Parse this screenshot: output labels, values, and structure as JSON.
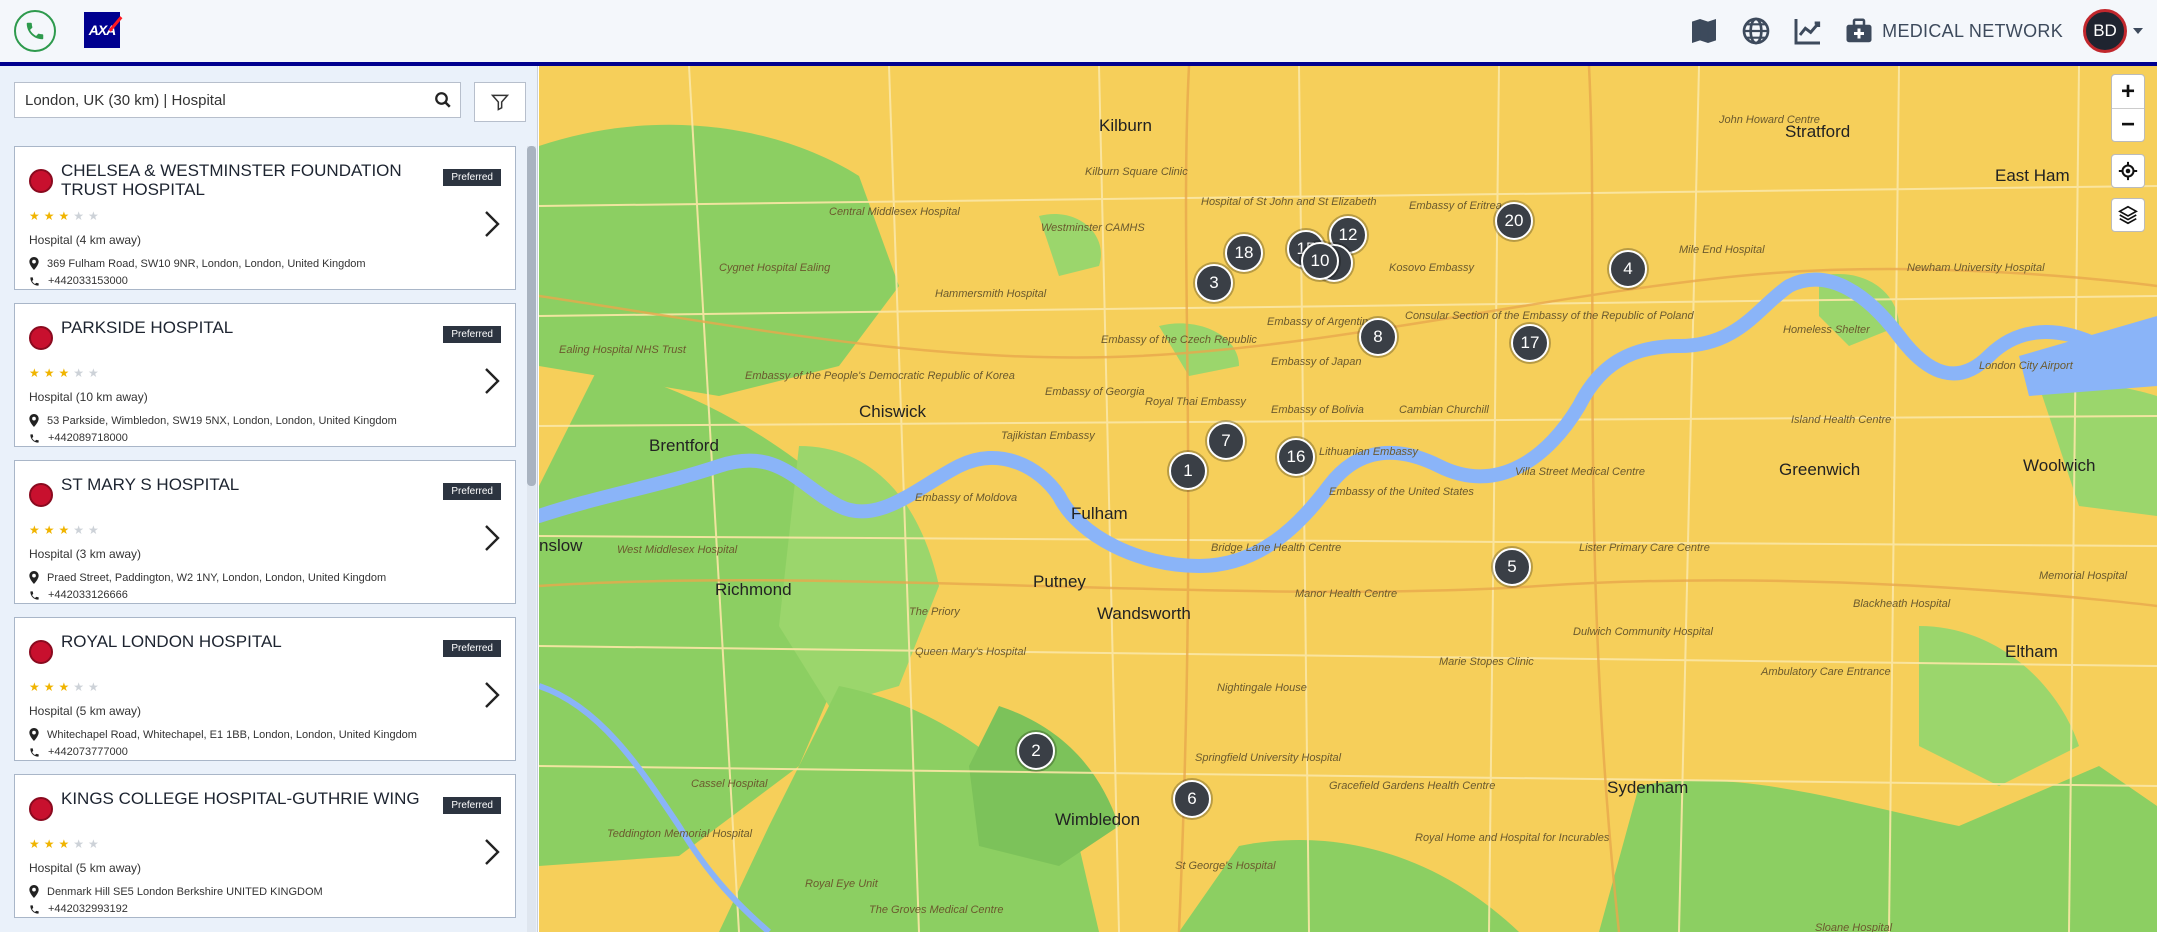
{
  "header": {
    "phone_icon": "phone-icon",
    "logo_text": "AXA",
    "icons": [
      "map-icon",
      "globe-icon",
      "chart-icon",
      "medical-kit-icon"
    ],
    "medical_network_label": "MEDICAL NETWORK",
    "avatar_initials": "BD",
    "brand_color": "#00008f",
    "accent_color": "#c8102e"
  },
  "search": {
    "value": "London, UK (30 km) | Hospital",
    "placeholder": ""
  },
  "results": [
    {
      "name": "CHELSEA & WESTMINSTER FOUNDATION TRUST HOSPITAL",
      "badge": "Preferred",
      "rating": 3,
      "type": "Hospital (4 km away)",
      "address": "369 Fulham Road, SW10 9NR, London, London, United Kingdom",
      "phone": "+442033153000"
    },
    {
      "name": "PARKSIDE HOSPITAL",
      "badge": "Preferred",
      "rating": 3,
      "type": "Hospital (10 km away)",
      "address": "53 Parkside, Wimbledon, SW19 5NX, London, London, United Kingdom",
      "phone": "+442089718000"
    },
    {
      "name": "ST MARY S HOSPITAL",
      "badge": "Preferred",
      "rating": 3,
      "type": "Hospital (3 km away)",
      "address": "Praed Street, Paddington, W2 1NY, London, London, United Kingdom",
      "phone": "+442033126666"
    },
    {
      "name": "ROYAL LONDON HOSPITAL",
      "badge": "Preferred",
      "rating": 3,
      "type": "Hospital (5 km away)",
      "address": "Whitechapel Road, Whitechapel, E1 1BB, London, London, United Kingdom",
      "phone": "+442073777000"
    },
    {
      "name": "KINGS COLLEGE HOSPITAL-GUTHRIE WING",
      "badge": "Preferred",
      "rating": 3,
      "type": "Hospital (5 km away)",
      "address": "Denmark Hill SE5 London Berkshire UNITED KINGDOM",
      "phone": "+442032993192"
    }
  ],
  "map": {
    "places": [
      {
        "id": "kilburn",
        "label": "Kilburn"
      },
      {
        "id": "stratford",
        "label": "Stratford"
      },
      {
        "id": "east-ham",
        "label": "East Ham"
      },
      {
        "id": "chiswick",
        "label": "Chiswick"
      },
      {
        "id": "brentford",
        "label": "Brentford"
      },
      {
        "id": "fulham",
        "label": "Fulham"
      },
      {
        "id": "putney",
        "label": "Putney"
      },
      {
        "id": "richmond",
        "label": "Richmond"
      },
      {
        "id": "wandsworth",
        "label": "Wandsworth"
      },
      {
        "id": "greenwich",
        "label": "Greenwich"
      },
      {
        "id": "woolwich",
        "label": "Woolwich"
      },
      {
        "id": "eltham",
        "label": "Eltham"
      },
      {
        "id": "wimbledon",
        "label": "Wimbledon"
      },
      {
        "id": "sydenham",
        "label": "Sydenham"
      },
      {
        "id": "hounslow",
        "label": "nslow"
      }
    ],
    "small_labels": [
      {
        "id": "central-middlesex",
        "label": "Central Middlesex Hospital"
      },
      {
        "id": "hammersmith",
        "label": "Hammersmith Hospital"
      },
      {
        "id": "west-middlesex",
        "label": "West Middlesex Hospital"
      },
      {
        "id": "the-priory",
        "label": "The Priory"
      },
      {
        "id": "queen-marys",
        "label": "Queen Mary's Hospital"
      },
      {
        "id": "bridge-lane",
        "label": "Bridge Lane Health Centre"
      },
      {
        "id": "manor-health",
        "label": "Manor Health Centre"
      },
      {
        "id": "nightingale",
        "label": "Nightingale House"
      },
      {
        "id": "marie-stopes",
        "label": "Marie Stopes Clinic"
      },
      {
        "id": "dulwich",
        "label": "Dulwich Community Hospital"
      },
      {
        "id": "lister",
        "label": "Lister Primary Care Centre"
      },
      {
        "id": "mile-end",
        "label": "Mile End Hospital"
      },
      {
        "id": "newham",
        "label": "Newham University Hospital"
      },
      {
        "id": "blackheath",
        "label": "Blackheath Hospital"
      },
      {
        "id": "memorial",
        "label": "Memorial Hospital"
      },
      {
        "id": "springfield",
        "label": "Springfield University Hospital"
      },
      {
        "id": "st-georges",
        "label": "St George's Hospital"
      },
      {
        "id": "cassel",
        "label": "Cassel Hospital"
      },
      {
        "id": "teddington",
        "label": "Teddington Memorial Hospital"
      },
      {
        "id": "london-city-airport",
        "label": "London City Airport"
      },
      {
        "id": "embassy-japan",
        "label": "Embassy of Japan"
      },
      {
        "id": "embassy-argentina",
        "label": "Embassy of Argentina"
      },
      {
        "id": "embassy-georgia",
        "label": "Embassy of Georgia"
      },
      {
        "id": "embassy-bolivia",
        "label": "Embassy of Bolivia"
      },
      {
        "id": "royal-thai",
        "label": "Royal Thai Embassy"
      },
      {
        "id": "tajikistan",
        "label": "Tajikistan Embassy"
      },
      {
        "id": "lithuanian",
        "label": "Lithuanian Embassy"
      },
      {
        "id": "us-embassy",
        "label": "Embassy of the United States"
      },
      {
        "id": "moldova",
        "label": "Embassy of Moldova"
      },
      {
        "id": "korea",
        "label": "Embassy of the People's Democratic Republic of Korea"
      },
      {
        "id": "cambian",
        "label": "Cambian Churchill"
      },
      {
        "id": "villa-street",
        "label": "Villa Street Medical Centre"
      },
      {
        "id": "island-health",
        "label": "Island Health Centre"
      },
      {
        "id": "ambulatory",
        "label": "Ambulatory Care Entrance"
      },
      {
        "id": "gracefield",
        "label": "Gracefield Gardens Health Centre"
      },
      {
        "id": "royal-home",
        "label": "Royal Home and Hospital for Incurables"
      },
      {
        "id": "royal-eye",
        "label": "Royal Eye Unit"
      },
      {
        "id": "sloane",
        "label": "Sloane Hospital"
      },
      {
        "id": "groves",
        "label": "The Groves Medical Centre"
      },
      {
        "id": "ealing-nhs",
        "label": "Ealing Hospital NHS Trust"
      },
      {
        "id": "cygnet",
        "label": "Cygnet Hospital Ealing"
      },
      {
        "id": "kilburn-square",
        "label": "Kilburn Square Clinic"
      },
      {
        "id": "westminster-camhs",
        "label": "Westminster CAMHS"
      },
      {
        "id": "st-john",
        "label": "Hospital of St John and St Elizabeth"
      },
      {
        "id": "eritrea",
        "label": "Embassy of Eritrea"
      },
      {
        "id": "kosovo",
        "label": "Kosovo Embassy"
      },
      {
        "id": "poland",
        "label": "Consular Section of the Embassy of the Republic of Poland"
      },
      {
        "id": "czech",
        "label": "Embassy of the Czech Republic"
      },
      {
        "id": "homeless-shelter",
        "label": "Homeless Shelter"
      },
      {
        "id": "john-howard",
        "label": "John Howard Centre"
      }
    ],
    "clusters": [
      {
        "id": "c20",
        "count": "20"
      },
      {
        "id": "c12",
        "count": "12"
      },
      {
        "id": "c15",
        "count": "15"
      },
      {
        "id": "c18",
        "count": "18"
      },
      {
        "id": "c3",
        "count": "3"
      },
      {
        "id": "c9",
        "count": "9"
      },
      {
        "id": "c10",
        "count": "10"
      },
      {
        "id": "c8",
        "count": "8"
      },
      {
        "id": "c4",
        "count": "4"
      },
      {
        "id": "c17",
        "count": "17"
      },
      {
        "id": "c7",
        "count": "7"
      },
      {
        "id": "c16",
        "count": "16"
      },
      {
        "id": "c1",
        "count": "1"
      },
      {
        "id": "c5",
        "count": "5"
      },
      {
        "id": "c2",
        "count": "2"
      },
      {
        "id": "c6",
        "count": "6"
      }
    ],
    "zoom_in_label": "+",
    "zoom_out_label": "−",
    "controls": [
      "locate-icon",
      "layers-icon"
    ],
    "colors": {
      "urban": "#f6cf5a",
      "green": "#8ccf62",
      "water": "#8ab4f8",
      "cluster": "#3a3f46"
    }
  }
}
